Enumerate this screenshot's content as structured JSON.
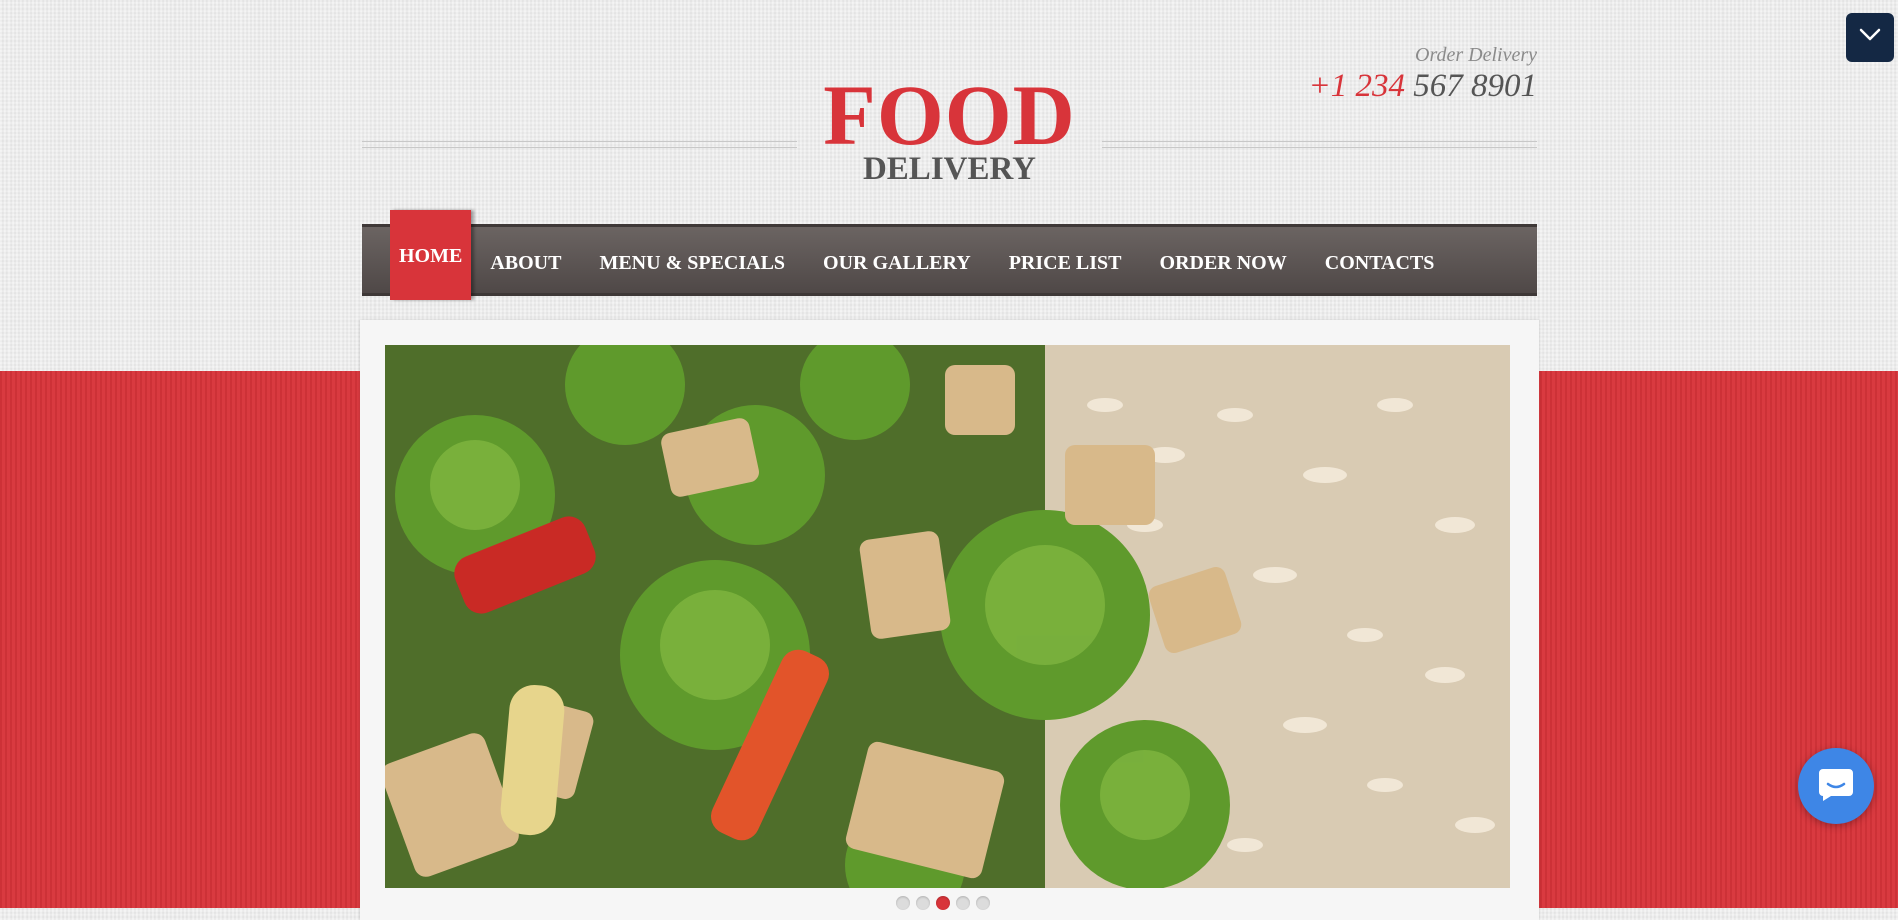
{
  "header": {
    "order_label": "Order Delivery",
    "phone_code": "+1 234",
    "phone_rest": "567 8901"
  },
  "logo": {
    "title": "FOOD",
    "subtitle": "DELIVERY"
  },
  "nav": {
    "items": [
      {
        "label": "HOME",
        "active": true
      },
      {
        "label": "ABOUT"
      },
      {
        "label": "MENU & SPECIALS"
      },
      {
        "label": "OUR GALLERY"
      },
      {
        "label": "PRICE LIST"
      },
      {
        "label": "ORDER NOW"
      },
      {
        "label": "CONTACTS"
      }
    ]
  },
  "slider": {
    "total_slides": 5,
    "current_slide": 3
  },
  "widgets": {
    "collapse_icon": "chevron-down-icon",
    "chat_icon": "chat-bubble-icon"
  },
  "colors": {
    "accent": "#d8343a",
    "nav_bg": "#5a5352",
    "collapse_bg": "#142844",
    "chat_bg": "#3e86e6"
  }
}
